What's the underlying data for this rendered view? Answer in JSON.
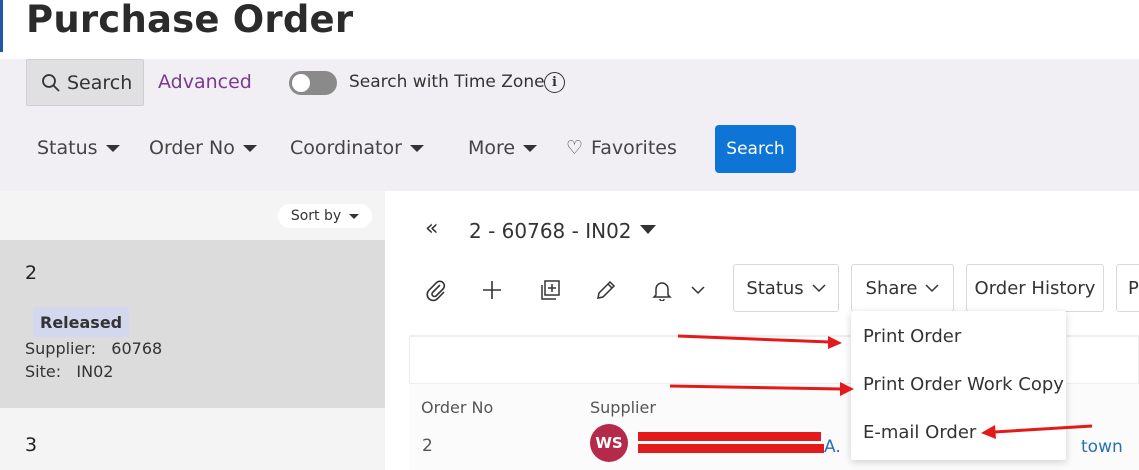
{
  "page": {
    "title": "Purchase Order"
  },
  "search": {
    "search_tab_label": "Search",
    "advanced_label": "Advanced",
    "time_zone_label": "Search with Time Zone",
    "search_button": "Search",
    "filters": [
      "Status",
      "Order No",
      "Coordinator",
      "More"
    ],
    "favorites_label": "Favorites"
  },
  "list": {
    "sort_label": "Sort by",
    "items": [
      {
        "number": "2",
        "status": "Released",
        "supplier_label": "Supplier:",
        "supplier": "60768",
        "site_label": "Site:",
        "site": "IN02"
      },
      {
        "number": "3"
      }
    ]
  },
  "record": {
    "title": "2 - 60768 - IN02",
    "toolbar": {
      "status_label": "Status",
      "share_label": "Share",
      "order_history_label": "Order History",
      "partial_label": "P"
    }
  },
  "share_menu": {
    "items": [
      "Print Order",
      "Print Order Work Copy",
      "E-mail Order"
    ]
  },
  "table": {
    "columns": [
      "Order No",
      "Supplier"
    ],
    "row": {
      "order_no": "2",
      "supplier_initials": "WS",
      "supplier_suffix": "A.",
      "right_fragment": "town"
    }
  },
  "colors": {
    "accent_blue": "#0e74d6",
    "link_purple": "#7b3a8e",
    "annotation_red": "#e41a1a",
    "avatar": "#b52a4a"
  }
}
